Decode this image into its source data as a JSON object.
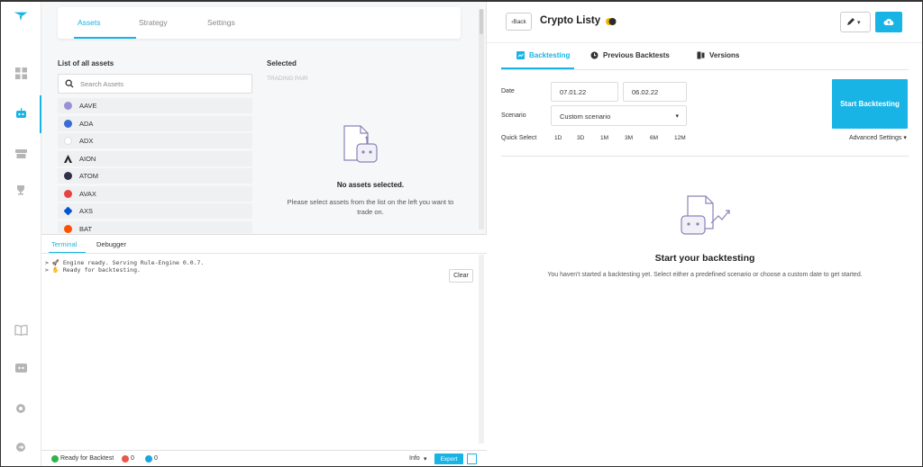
{
  "left_tabs": {
    "assets": "Assets",
    "strategy": "Strategy",
    "settings": "Settings"
  },
  "assets": {
    "title": "List of all assets",
    "search_placeholder": "Search Assets",
    "items": [
      {
        "name": "AAVE",
        "color": "#9c8fd6"
      },
      {
        "name": "ADA",
        "color": "#3c6ad6"
      },
      {
        "name": "ADX",
        "color": "#e8e8e8"
      },
      {
        "name": "AION",
        "color": "#222222"
      },
      {
        "name": "ATOM",
        "color": "#2e3148"
      },
      {
        "name": "AVAX",
        "color": "#e84142"
      },
      {
        "name": "AXS",
        "color": "#0055d5"
      },
      {
        "name": "BAT",
        "color": "#ff5000"
      }
    ]
  },
  "selected": {
    "title": "Selected",
    "trading_pair": "TRADING PAIR",
    "empty_title": "No assets selected.",
    "empty_sub": "Please select assets from the list on the left you want to trade on."
  },
  "terminal": {
    "tab_terminal": "Terminal",
    "tab_debugger": "Debugger",
    "lines": [
      "> 🚀 Engine ready. Serving Rule-Engine 0.0.7.",
      "> ✋ Ready for backtesting."
    ],
    "clear_label": "Clear"
  },
  "status": {
    "ready": "Ready for Backtest",
    "errors": "0",
    "infos": "0",
    "level": "Info",
    "level_caret": "▾",
    "export": "Export"
  },
  "header": {
    "back": "Back",
    "back_icon": "‹",
    "title": "Crypto Listy",
    "edit_caret": "▾"
  },
  "right_tabs": {
    "backtesting": "Backtesting",
    "previous": "Previous Backtests",
    "versions": "Versions"
  },
  "form": {
    "date_label": "Date",
    "date_from": "07.01.22",
    "date_to": "06.02.22",
    "scenario_label": "Scenario",
    "scenario_value": "Custom scenario",
    "scenario_caret": "▾",
    "quick_label": "Quick Select",
    "quick": [
      "1D",
      "3D",
      "1M",
      "3M",
      "6M",
      "12M"
    ],
    "start": "Start Backtesting",
    "advanced": "Advanced Settings ▾"
  },
  "empty_backtest": {
    "title": "Start your backtesting",
    "sub": "You haven't started a backtesting yet. Select either a predefined scenario or choose a custom date to get started."
  },
  "colors": {
    "accent": "#19b4e6",
    "success": "#2eb44a",
    "error": "#e8574a",
    "info": "#19a7e0"
  }
}
